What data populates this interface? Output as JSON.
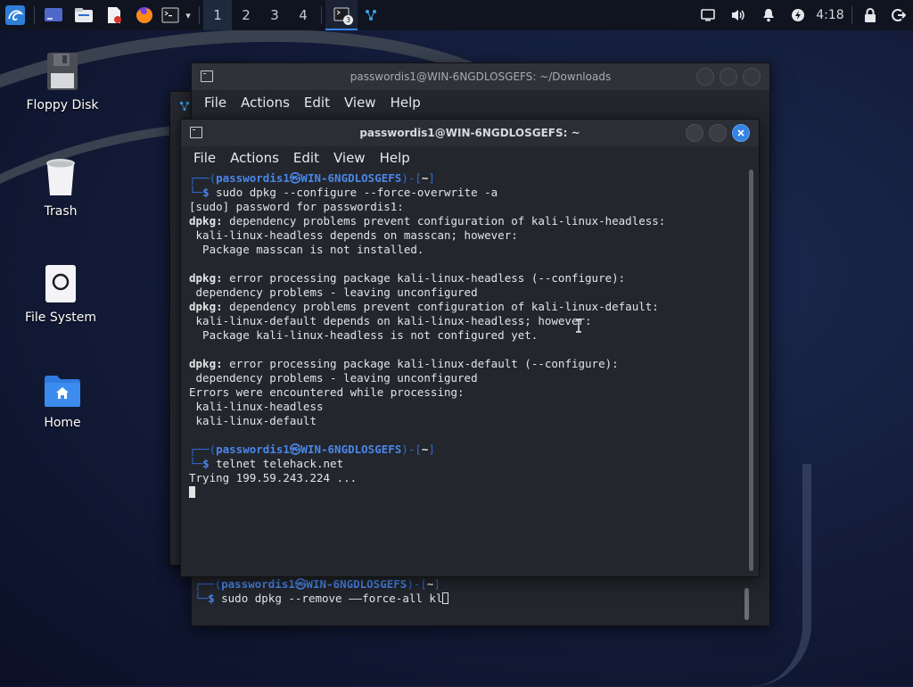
{
  "panel": {
    "workspaces": [
      "1",
      "2",
      "3",
      "4"
    ],
    "terminal_badge": "3",
    "clock": "4:18"
  },
  "desktop": {
    "icons": [
      {
        "label": "Floppy Disk"
      },
      {
        "label": "Trash"
      },
      {
        "label": "File System"
      },
      {
        "label": "Home"
      }
    ]
  },
  "back_window": {
    "title": "passwordis1@WIN-6NGDLOSGEFS: ~/Downloads",
    "menu": [
      "File",
      "Actions",
      "Edit",
      "View",
      "Help"
    ],
    "prompt_user": "passwordis1",
    "prompt_host": "WIN-6NGDLOSGEFS",
    "prompt_dir": "~",
    "command": "sudo dpkg --remove ——force-all kl"
  },
  "front_window": {
    "title": "passwordis1@WIN-6NGDLOSGEFS: ~",
    "menu": [
      "File",
      "Actions",
      "Edit",
      "View",
      "Help"
    ],
    "prompt_user": "passwordis1",
    "prompt_host": "WIN-6NGDLOSGEFS",
    "prompt_dir": "~",
    "cmd1": "sudo dpkg --configure --force-overwrite -a",
    "lines": [
      {
        "bold": "",
        "text": "[sudo] password for passwordis1:"
      },
      {
        "bold": "dpkg:",
        "text": " dependency problems prevent configuration of kali-linux-headless:"
      },
      {
        "bold": "",
        "text": " kali-linux-headless depends on masscan; however:"
      },
      {
        "bold": "",
        "text": "  Package masscan is not installed."
      },
      {
        "bold": "",
        "text": ""
      },
      {
        "bold": "dpkg:",
        "text": " error processing package kali-linux-headless (--configure):"
      },
      {
        "bold": "",
        "text": " dependency problems - leaving unconfigured"
      },
      {
        "bold": "dpkg:",
        "text": " dependency problems prevent configuration of kali-linux-default:"
      },
      {
        "bold": "",
        "text": " kali-linux-default depends on kali-linux-headless; however:"
      },
      {
        "bold": "",
        "text": "  Package kali-linux-headless is not configured yet."
      },
      {
        "bold": "",
        "text": ""
      },
      {
        "bold": "dpkg:",
        "text": " error processing package kali-linux-default (--configure):"
      },
      {
        "bold": "",
        "text": " dependency problems - leaving unconfigured"
      },
      {
        "bold": "",
        "text": "Errors were encountered while processing:"
      },
      {
        "bold": "",
        "text": " kali-linux-headless"
      },
      {
        "bold": "",
        "text": " kali-linux-default"
      }
    ],
    "cmd2": "telnet telehack.net",
    "trying": "Trying 199.59.243.224 ..."
  }
}
